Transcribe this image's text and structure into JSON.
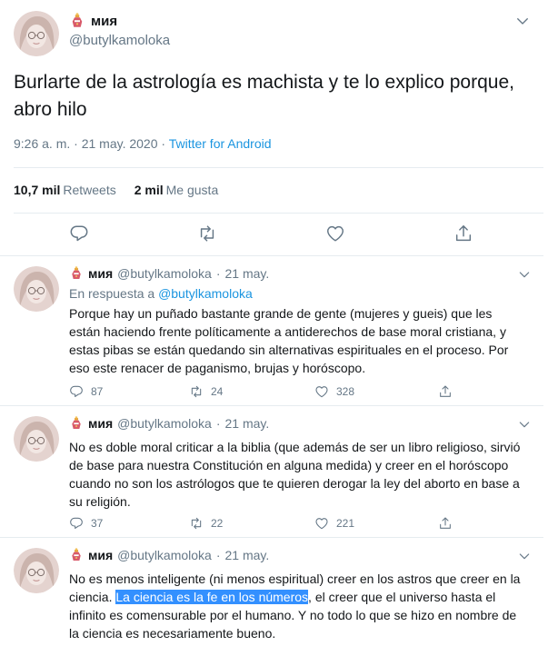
{
  "colors": {
    "text": "#14171a",
    "secondary": "#657786",
    "link": "#1b95e0",
    "border": "#e6ecf0",
    "highlight": "#3390ff"
  },
  "main_tweet": {
    "display_name": "мия",
    "handle": "@butylkamoloka",
    "text": "Burlarte de la astrología es machista y te lo explico porque, abro hilo",
    "time": "9:26 a. m. · 21 may. 2020 ·",
    "source": "Twitter for Android",
    "stats": {
      "retweets_count": "10,7 mil",
      "retweets_label": "Retweets",
      "likes_count": "2 mil",
      "likes_label": "Me gusta"
    },
    "icons": [
      "avatar",
      "crown-emoji-icon",
      "chevron-down-icon",
      "reply-icon",
      "retweet-icon",
      "like-icon",
      "share-icon"
    ]
  },
  "replies": [
    {
      "display_name": "мия",
      "handle": "@butylkamoloka",
      "date": "21 may.",
      "in_reply_prefix": "En respuesta a",
      "in_reply_mention": "@butylkamoloka",
      "text": "Porque hay un puñado bastante grande de gente (mujeres y gueis) que les están haciendo frente políticamente a antiderechos de base moral cristiana, y estas pibas se están quedando sin alternativas espirituales en el proceso. Por eso este renacer de paganismo, brujas y horóscopo.",
      "replies_count": "87",
      "retweets_count": "24",
      "likes_count": "328"
    },
    {
      "display_name": "мия",
      "handle": "@butylkamoloka",
      "date": "21 may.",
      "text": "No es doble moral criticar a la biblia (que además de ser un libro religioso, sirvió de base para nuestra Constitución en alguna medida) y creer en el horóscopo cuando no son los astrólogos que te quieren derogar la ley del aborto en base a su religión.",
      "replies_count": "37",
      "retweets_count": "22",
      "likes_count": "221"
    },
    {
      "display_name": "мия",
      "handle": "@butylkamoloka",
      "date": "21 may.",
      "text_before": "No es menos inteligente (ni menos espiritual) creer en los astros que creer en la ciencia. ",
      "text_highlight": "La ciencia es la fe en los números",
      "text_after": ", el creer que el universo hasta el infinito es comensurable por el humano. Y no todo lo que se hizo en nombre de la ciencia es necesariamente bueno."
    }
  ]
}
